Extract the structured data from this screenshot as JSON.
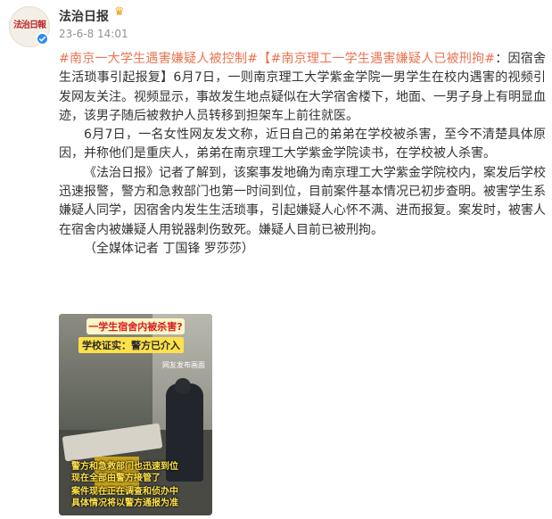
{
  "account": {
    "name": "法治日报",
    "timestamp": "23-6-8 14:01",
    "avatar_logo_text": "法治日報",
    "badge_icon": "crown-icon",
    "verified_icon": "check-icon"
  },
  "post": {
    "topic1": "#南京一大学生遇害嫌疑人被控制#",
    "topic2": "【#南京理工一学生遇害嫌疑人已被刑拘#",
    "para1_rest": "：因宿舍生活琐事引起报复】6月7日，一则南京理工大学紫金学院一男学生在校内遇害的视频引发网友关注。视频显示，事故发生地点疑似在大学宿舍楼下，地面、一男子身上有明显血迹，该男子随后被救护人员转移到担架车上前往就医。",
    "para2": "6月7日，一名女性网友发文称，近日自己的弟弟在学校被杀害，至今不清楚具体原因，并称他们是重庆人，弟弟在南京理工大学紫金学院读书，在学校被人杀害。",
    "para3": "《法治日报》记者了解到，该案事发地确为南京理工大学紫金学院校内，案发后学校迅速报警，警方和急救部门也第一时间到位，目前案件基本情况已初步查明。被害学生系嫌疑人同学，因宿舍内发生生活琐事，引起嫌疑人心怀不满、进而报复。案发时，被害人在宿舍内被嫌疑人用锐器刺伤致死。嫌疑人目前已被刑拘。",
    "para4": "（全媒体记者 丁国锋 罗莎莎）"
  },
  "media": {
    "caption_top": "一学生宿舍内被杀害?",
    "caption_badge": "学校证实：警方已介入",
    "caption_source": "网友发布画面",
    "subtitle1": "警方和急救部门也迅速到位",
    "subtitle2": "现在全部由警方接管了",
    "subtitle3": "案件现在正在调查和侦办中",
    "subtitle4": "具体情况将以警方通报为准"
  },
  "colors": {
    "topic": "#eb7350",
    "text": "#333333",
    "time": "#939393",
    "verified": "#2e8cf0"
  }
}
